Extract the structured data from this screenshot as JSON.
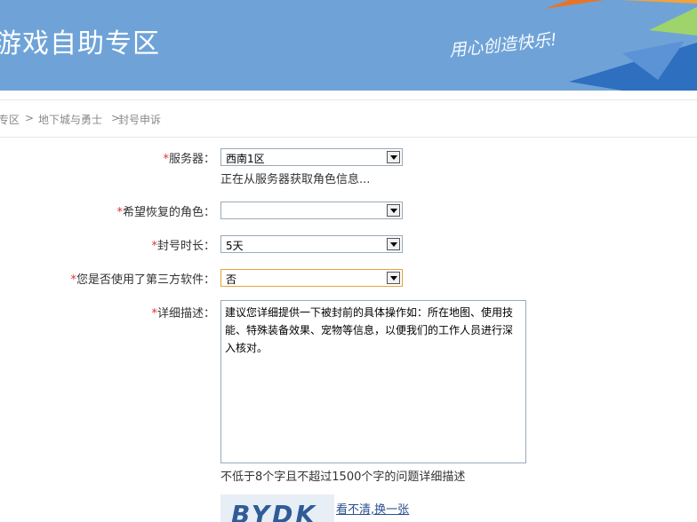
{
  "banner": {
    "title": "游戏自助专区",
    "slogan": "用心创造快乐!"
  },
  "breadcrumb": {
    "item1": "专区",
    "sep1": ">",
    "item2": "地下城与勇士",
    "sep2": ">",
    "item3": "封号申诉"
  },
  "form": {
    "required_mark": "*",
    "server": {
      "label": "服务器：",
      "value": "西南1区",
      "loading_note": "正在从服务器获取角色信息..."
    },
    "role": {
      "label": "希望恢复的角色：",
      "value": ""
    },
    "ban_duration": {
      "label": "封号时长：",
      "value": "5天"
    },
    "third_party": {
      "label": "您是否使用了第三方软件：",
      "value": "否"
    },
    "description": {
      "label": "详细描述：",
      "value": "建议您详细提供一下被封前的具体操作如：所在地图、使用技能、特殊装备效果、宠物等信息，以便我们的工作人员进行深入核对。",
      "hint": "不低于8个字且不超过1500个字的问题详细描述"
    },
    "captcha": {
      "text": "BYDK",
      "refresh_label": "看不清,换一张"
    }
  }
}
